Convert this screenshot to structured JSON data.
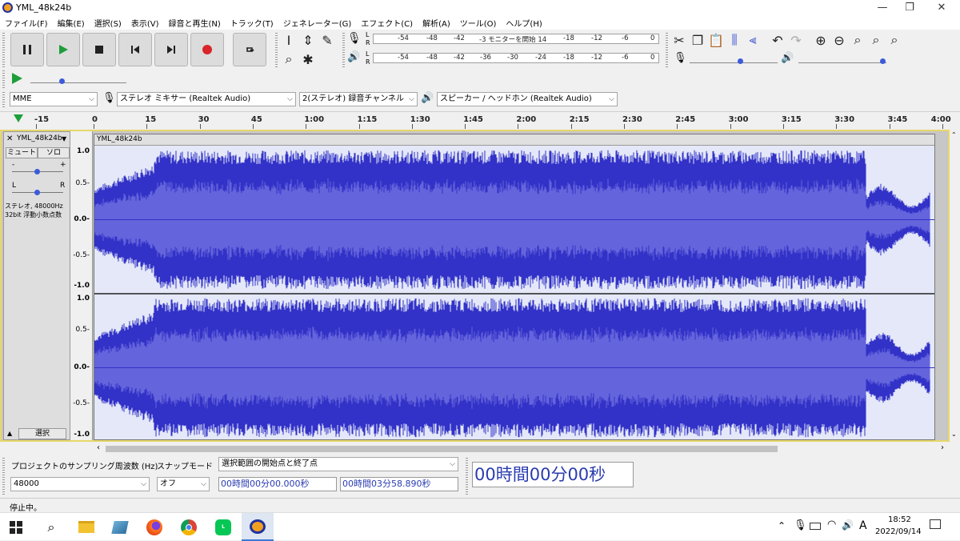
{
  "window": {
    "title": "YML_48k24b"
  },
  "menu": [
    "ファイル(F)",
    "編集(E)",
    "選択(S)",
    "表示(V)",
    "録音と再生(N)",
    "トラック(T)",
    "ジェネレーター(G)",
    "エフェクト(C)",
    "解析(A)",
    "ツール(O)",
    "ヘルプ(H)"
  ],
  "meters": {
    "record_ticks": [
      "-54",
      "-48",
      "-42",
      "-3 モニターを開始 14",
      "-18",
      "-12",
      "-6",
      "0"
    ],
    "playback_ticks": [
      "-54",
      "-48",
      "-42",
      "-36",
      "-30",
      "-24",
      "-18",
      "-12",
      "-6",
      "0"
    ],
    "lr": [
      "L",
      "R"
    ]
  },
  "colors": {
    "waveform": "#3232c8",
    "waveform_rms": "#6464dc",
    "track_bg": "#e4e8f8"
  },
  "device": {
    "host": "MME",
    "input": "ステレオ ミキサー (Realtek Audio)",
    "channels": "2(ステレオ) 録音チャンネル",
    "output": "スピーカー / ヘッドホン (Realtek Audio)"
  },
  "ruler": [
    "-15",
    "0",
    "15",
    "30",
    "45",
    "1:00",
    "1:15",
    "1:30",
    "1:45",
    "2:00",
    "2:15",
    "2:30",
    "2:45",
    "3:00",
    "3:15",
    "3:30",
    "3:45",
    "4:00"
  ],
  "track": {
    "name": "YML_48k24b",
    "mute": "ミュート",
    "solo": "ソロ",
    "gain_minus": "-",
    "gain_plus": "+",
    "pan_l": "L",
    "pan_r": "R",
    "info1": "ステレオ, 48000Hz",
    "info2": "32bit 浮動小数点数",
    "select": "選択",
    "scale": [
      "1.0",
      "0.5-",
      "0.0-",
      "-0.5-",
      "-1.0"
    ],
    "scale2": [
      "1.0",
      "0.5-",
      "0.0-",
      "-0.5-",
      "-1.0"
    ]
  },
  "bottom": {
    "rate_label": "プロジェクトのサンプリング周波数 (Hz)",
    "rate_value": "48000",
    "snap_label": "スナップモード",
    "snap_value": "オフ",
    "sel_label": "選択範囲の開始点と終了点",
    "start": "00時間00分00.000秒",
    "end": "00時間03分58.890秒",
    "big_time": "00時間00分00秒"
  },
  "status": "停止中。",
  "taskbar": {
    "ime": "A",
    "time": "18:52",
    "date": "2022/09/14"
  }
}
